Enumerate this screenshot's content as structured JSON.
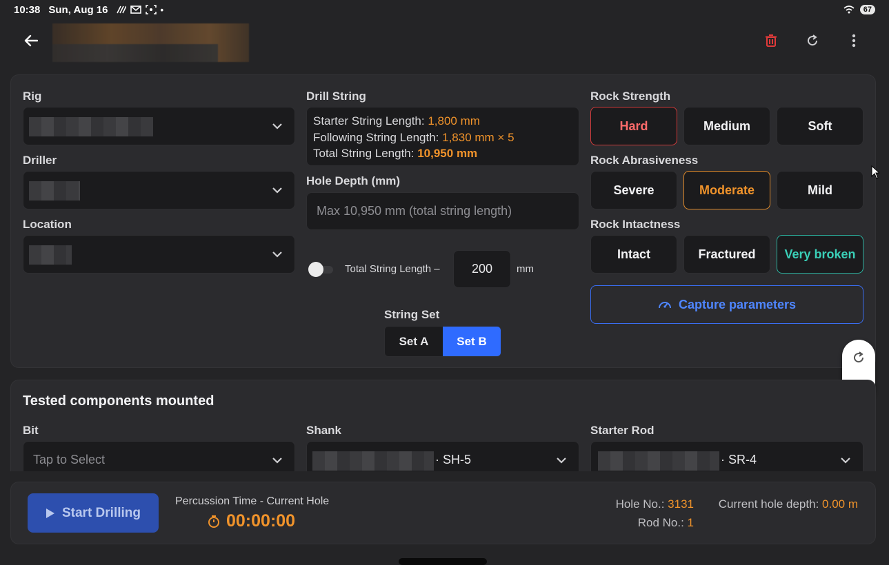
{
  "status_bar": {
    "time": "10:38",
    "date": "Sun, Aug 16",
    "battery": "67"
  },
  "colors": {
    "accent_orange": "#f0932b",
    "accent_blue": "#2f6bff",
    "hard_red": "#d23b3b",
    "very_broken_teal": "#2bb3a0",
    "delete_icon_red": "#e03a3a"
  },
  "params": {
    "rig_label": "Rig",
    "driller_label": "Driller",
    "location_label": "Location",
    "drill_string_label": "Drill String",
    "starter_label": "Starter String Length: ",
    "starter_value": "1,800 mm",
    "following_label": "Following String Length: ",
    "following_value": "1,830 mm × 5",
    "total_label": "Total String Length: ",
    "total_value": "10,950 mm",
    "hole_depth_label": "Hole Depth (mm)",
    "hole_depth_placeholder": "Max 10,950 mm (total string length)",
    "toggle_label": "Total String Length –",
    "offset_value": "200",
    "offset_unit": "mm",
    "string_set_label": "String Set",
    "set_a": "Set A",
    "set_b": "Set B",
    "selected_set": "Set B"
  },
  "rock": {
    "strength_label": "Rock Strength",
    "strength_options": [
      "Hard",
      "Medium",
      "Soft"
    ],
    "strength_selected": "Hard",
    "abrasiveness_label": "Rock Abrasiveness",
    "abrasiveness_options": [
      "Severe",
      "Moderate",
      "Mild"
    ],
    "abrasiveness_selected": "Moderate",
    "intactness_label": "Rock Intactness",
    "intactness_options": [
      "Intact",
      "Fractured",
      "Very broken"
    ],
    "intactness_selected": "Very broken",
    "capture_button": "Capture parameters"
  },
  "components": {
    "title": "Tested components mounted",
    "bit_label": "Bit",
    "bit_placeholder": "Tap to Select",
    "shank_label": "Shank",
    "shank_value": "· SH-5",
    "starter_rod_label": "Starter Rod",
    "starter_rod_value": "· SR-4"
  },
  "footer": {
    "start_button": "Start Drilling",
    "percussion_label": "Percussion Time - Current Hole",
    "timer": "00:00:00",
    "hole_no_label": "Hole No.: ",
    "hole_no_value": "3131",
    "rod_no_label": "Rod No.: ",
    "rod_no_value": "1",
    "depth_label": "Current hole depth: ",
    "depth_value": "0.00 m"
  }
}
